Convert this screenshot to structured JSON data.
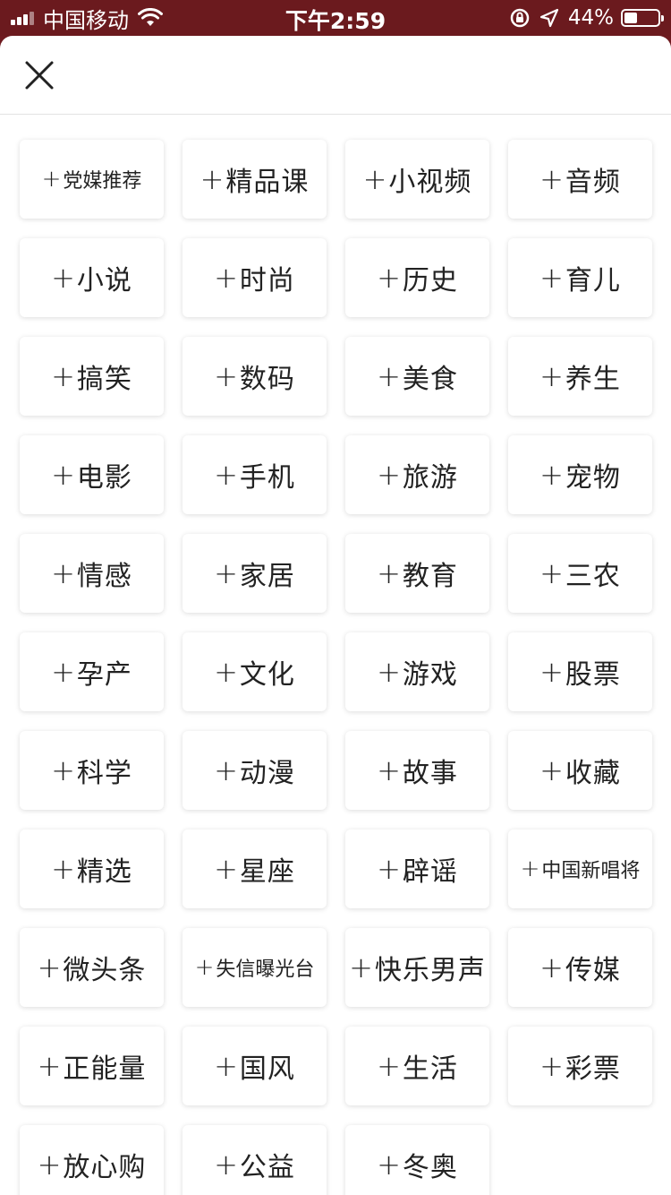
{
  "status_bar": {
    "carrier": "中国移动",
    "time": "下午2:59",
    "battery_percent": "44%",
    "battery_level": 0.44,
    "icons": [
      "signal-icon",
      "wifi-icon",
      "rotation-lock-icon",
      "location-icon",
      "battery-icon"
    ]
  },
  "header": {
    "close_icon": "close-icon"
  },
  "channels": [
    "党媒推荐",
    "精品课",
    "小视频",
    "音频",
    "小说",
    "时尚",
    "历史",
    "育儿",
    "搞笑",
    "数码",
    "美食",
    "养生",
    "电影",
    "手机",
    "旅游",
    "宠物",
    "情感",
    "家居",
    "教育",
    "三农",
    "孕产",
    "文化",
    "游戏",
    "股票",
    "科学",
    "动漫",
    "故事",
    "收藏",
    "精选",
    "星座",
    "辟谣",
    "中国新唱将",
    "微头条",
    "失信曝光台",
    "快乐男声",
    "传媒",
    "正能量",
    "国风",
    "生活",
    "彩票",
    "放心购",
    "公益",
    "冬奥"
  ],
  "plus_symbol": "+",
  "colors": {
    "status_bar": "#6b1a1e",
    "tile_text": "#222222",
    "sheet_bg": "#ffffff"
  }
}
